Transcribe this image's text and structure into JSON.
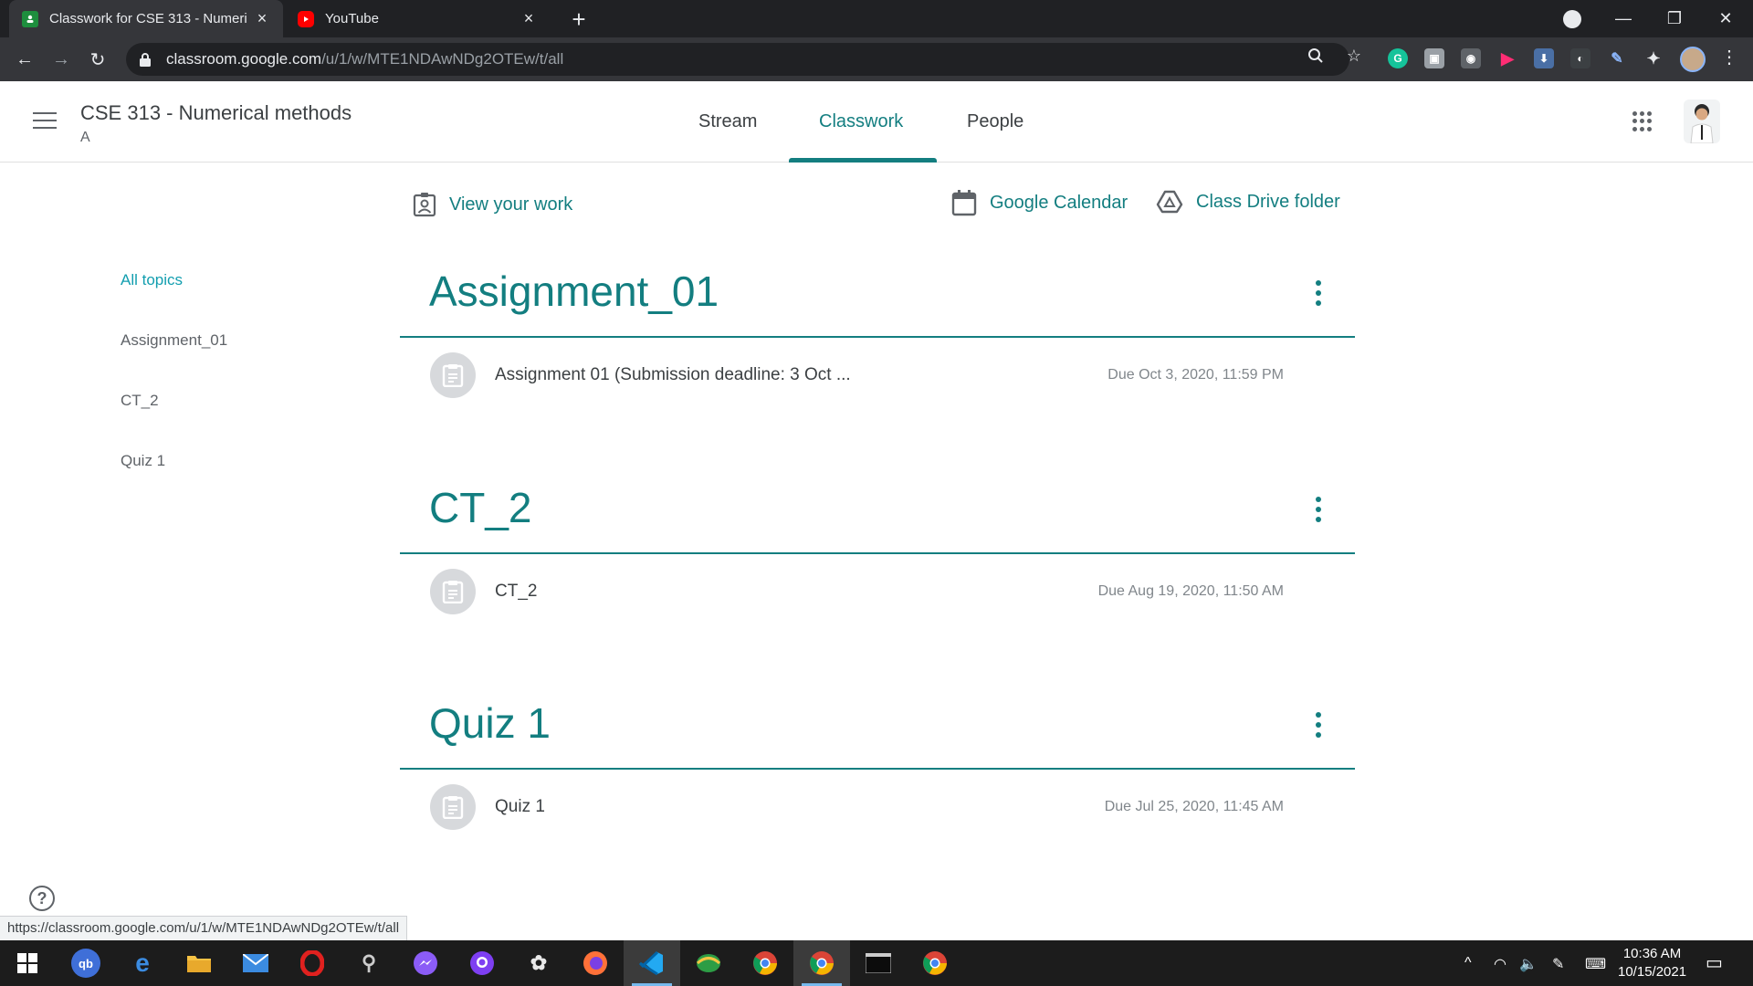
{
  "browser": {
    "tabs": [
      {
        "title": "Classwork for CSE 313 - Numeric",
        "active": true
      },
      {
        "title": "YouTube",
        "active": false
      }
    ],
    "url_host": "classroom.google.com",
    "url_path": "/u/1/w/MTE1NDAwNDg2OTEw/t/all",
    "status_url": "https://classroom.google.com/u/1/w/MTE1NDAwNDg2OTEw/t/all"
  },
  "header": {
    "course_title": "CSE 313 - Numerical methods",
    "section": "A",
    "tabs": [
      "Stream",
      "Classwork",
      "People"
    ],
    "active_tab": "Classwork"
  },
  "actions": {
    "view_work": "View your work",
    "calendar": "Google Calendar",
    "drive": "Class Drive folder"
  },
  "topics": [
    "All topics",
    "Assignment_01",
    "CT_2",
    "Quiz 1"
  ],
  "sections": [
    {
      "title": "Assignment_01",
      "item": "Assignment 01 (Submission deadline: 3 Oct ...",
      "due": "Due Oct 3, 2020, 11:59 PM"
    },
    {
      "title": "CT_2",
      "item": "CT_2",
      "due": "Due Aug 19, 2020, 11:50 AM"
    },
    {
      "title": "Quiz 1",
      "item": "Quiz 1",
      "due": "Due Jul 25, 2020, 11:45 AM"
    }
  ],
  "taskbar": {
    "time": "10:36 AM",
    "date": "10/15/2021"
  },
  "colors": {
    "accent": "#137e80",
    "chrome_dark": "#202124",
    "chrome_toolbar": "#35363a"
  }
}
